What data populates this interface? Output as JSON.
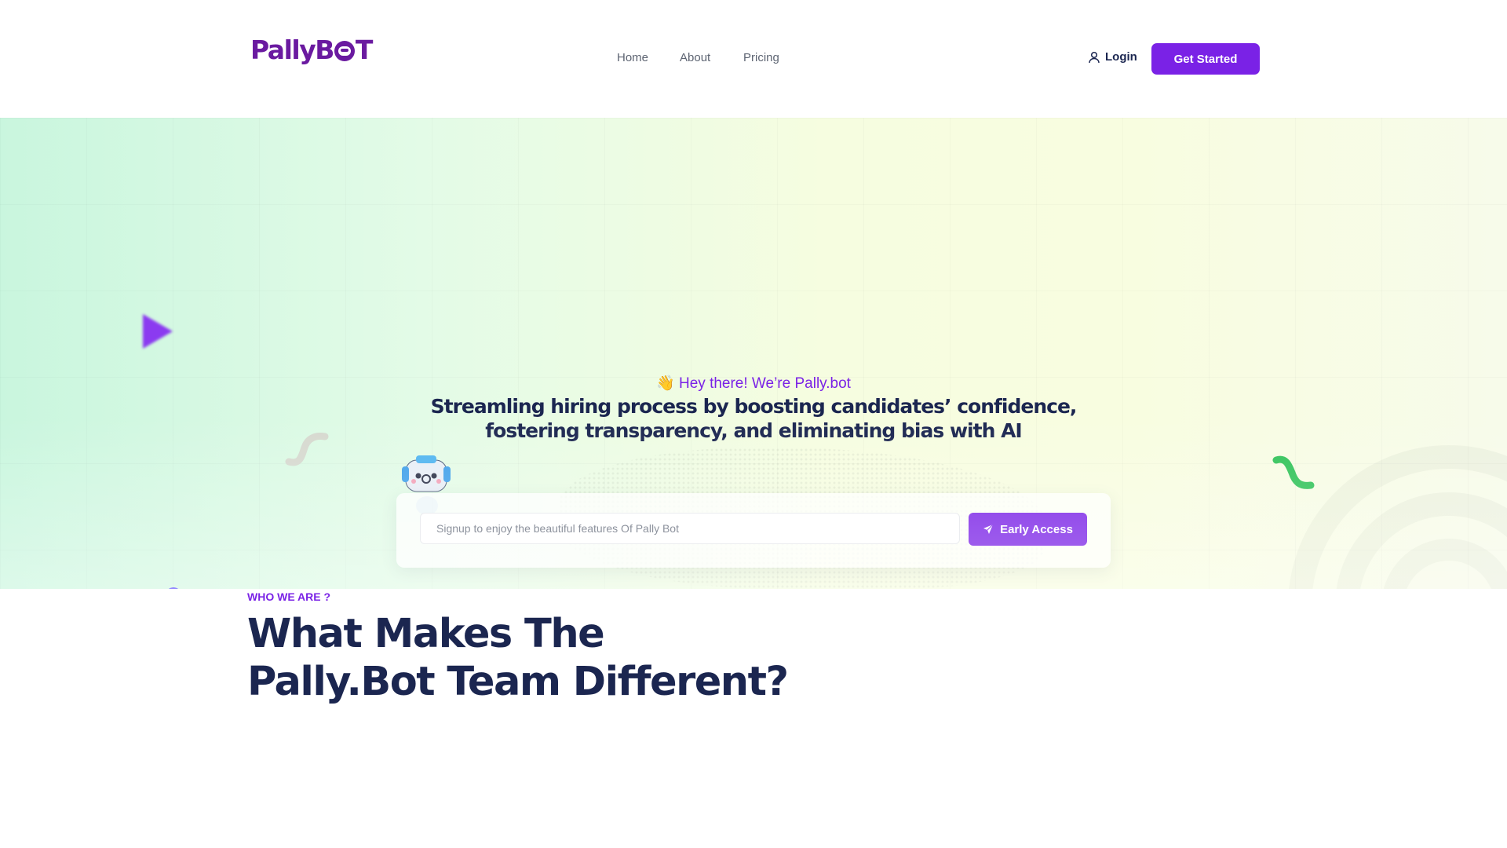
{
  "header": {
    "logo_text": "PallyBOT",
    "logo_pre": "PallyB",
    "logo_post": "T",
    "nav": [
      "Home",
      "About",
      "Pricing"
    ],
    "login_label": "Login",
    "cta_label": "Get Started"
  },
  "hero": {
    "greeting_emoji": "👋",
    "greeting": "Hey there! We’re Pally.bot",
    "headline": "Streamling hiring process by boosting candidates’ confidence, fostering transparency, and eliminating bias with AI",
    "signup_placeholder": "Signup to enjoy the beautiful features Of Pally Bot",
    "signup_value": "",
    "early_access_label": "Early Access"
  },
  "about": {
    "eyebrow": "WHO WE ARE ?",
    "title_line1": "What Makes The",
    "title_line2": "Pally.Bot Team Different?"
  },
  "icons": {
    "login": "user-icon",
    "early_access": "send-icon",
    "decor": [
      "play-shape-icon",
      "squiggle-icon",
      "dot-icon",
      "robot-icon",
      "rings-icon"
    ]
  },
  "colors": {
    "brand": "#7a22e6",
    "logo": "#6a1aa0",
    "heading": "#1b2650",
    "green_accent": "#2fc257"
  }
}
